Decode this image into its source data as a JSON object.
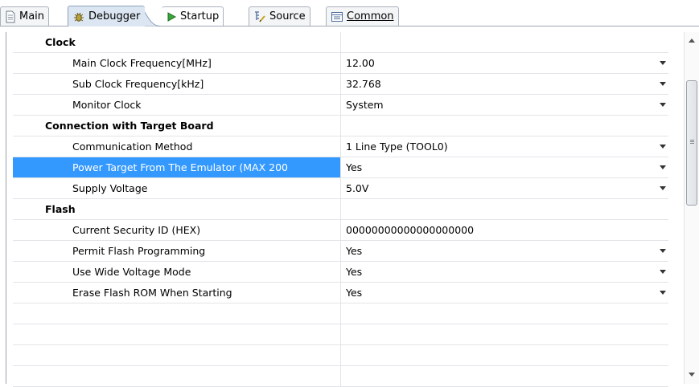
{
  "tabs": [
    {
      "label": "Main",
      "icon": "page-icon",
      "active": false
    },
    {
      "label": "Debugger",
      "icon": "bug-icon",
      "active": true
    },
    {
      "label": "Startup",
      "icon": "play-icon",
      "active": false
    },
    {
      "label": "Source",
      "icon": "source-icon",
      "active": false
    },
    {
      "label": "Common",
      "icon": "common-icon",
      "active": false
    }
  ],
  "rows": [
    {
      "type": "cat",
      "name": "Clock",
      "value": ""
    },
    {
      "type": "item",
      "name": "Main Clock Frequency[MHz]",
      "value": "12.00",
      "dropdown": true
    },
    {
      "type": "item",
      "name": "Sub Clock Frequency[kHz]",
      "value": "32.768",
      "dropdown": true
    },
    {
      "type": "item",
      "name": "Monitor Clock",
      "value": "System",
      "dropdown": true
    },
    {
      "type": "cat",
      "name": "Connection with Target Board",
      "value": ""
    },
    {
      "type": "item",
      "name": "Communication Method",
      "value": "1 Line Type (TOOL0)",
      "dropdown": true
    },
    {
      "type": "item",
      "name": "Power Target From The Emulator (MAX 200",
      "value": "Yes",
      "dropdown": true,
      "selected": true
    },
    {
      "type": "item",
      "name": "Supply Voltage",
      "value": "5.0V",
      "dropdown": true
    },
    {
      "type": "cat",
      "name": "Flash",
      "value": ""
    },
    {
      "type": "item",
      "name": "Current Security ID (HEX)",
      "value": "00000000000000000000",
      "dropdown": false
    },
    {
      "type": "item",
      "name": "Permit Flash Programming",
      "value": "Yes",
      "dropdown": true
    },
    {
      "type": "item",
      "name": "Use Wide Voltage Mode",
      "value": "Yes",
      "dropdown": true
    },
    {
      "type": "item",
      "name": "Erase Flash ROM When Starting",
      "value": "Yes",
      "dropdown": true
    }
  ],
  "colors": {
    "selection": "#3399ff",
    "tab_active": "#dce6f2"
  }
}
